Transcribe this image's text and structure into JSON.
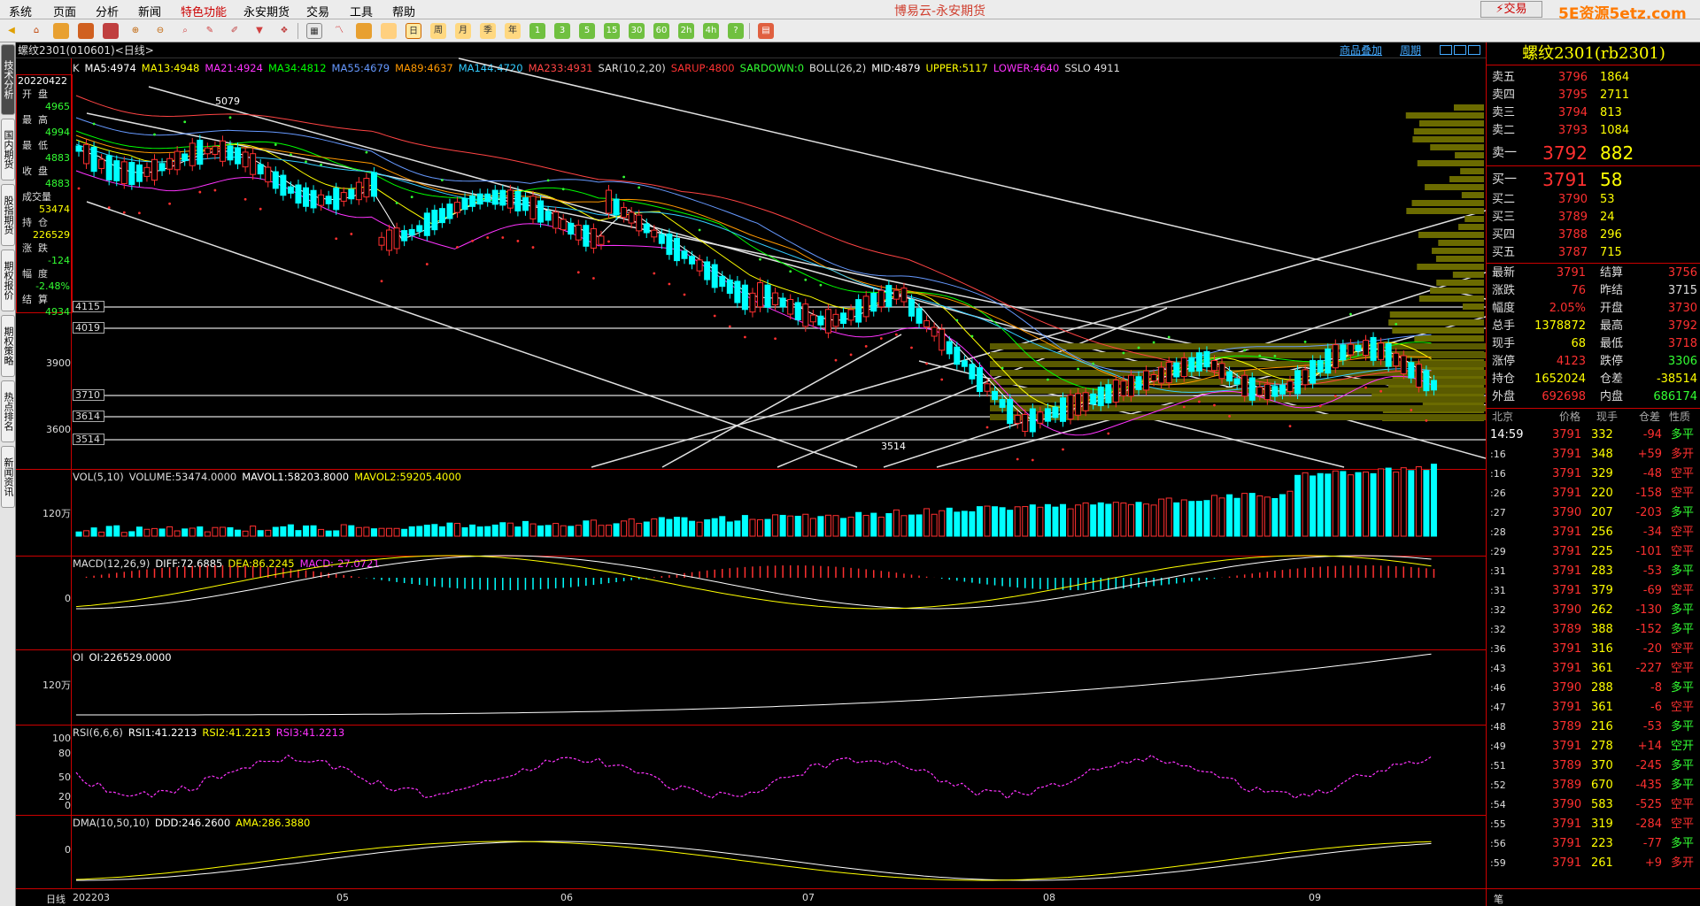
{
  "menu": [
    "系统",
    "页面",
    "分析",
    "新闻",
    "特色功能",
    "永安期货",
    "交易",
    "工具",
    "帮助"
  ],
  "app_title": "博易云-永安期货",
  "trade_button": "⚡交易",
  "watermark": "5E资源5etz.com",
  "side_tabs": [
    "技术分析",
    "国内期货",
    "股指期货",
    "期权报价",
    "期权策略",
    "热点排名",
    "新闻资讯"
  ],
  "chart_header": {
    "symbol": "螺纹2301(010601)<日线>",
    "overlay": "商品叠加",
    "period": "周期"
  },
  "info_panel": {
    "date": "20220422",
    "items": [
      {
        "label": "开盘",
        "value": "4965"
      },
      {
        "label": "最高",
        "value": "4994"
      },
      {
        "label": "最低",
        "value": "4883"
      },
      {
        "label": "收盘",
        "value": "4883"
      },
      {
        "label": "成交量",
        "value": "53474"
      },
      {
        "label": "持仓",
        "value": "226529"
      },
      {
        "label": "涨跌",
        "value": "-124"
      },
      {
        "label": "幅度",
        "value": "-2.48%"
      },
      {
        "label": "结算",
        "value": "4934"
      }
    ]
  },
  "main_indicators": [
    {
      "text": "K",
      "color": "#dddddd"
    },
    {
      "text": "MA5:4974",
      "color": "#ffffff"
    },
    {
      "text": "MA13:4948",
      "color": "#ffff00"
    },
    {
      "text": "MA21:4924",
      "color": "#ff33ff"
    },
    {
      "text": "MA34:4812",
      "color": "#00ff00"
    },
    {
      "text": "MA55:4679",
      "color": "#6699ff"
    },
    {
      "text": "MA89:4637",
      "color": "#ff9900"
    },
    {
      "text": "MA144:4720",
      "color": "#33ccff"
    },
    {
      "text": "MA233:4931",
      "color": "#ff4444"
    },
    {
      "text": "SAR(10,2,20)",
      "color": "#dddddd"
    },
    {
      "text": "SARUP:4800",
      "color": "#ff3333"
    },
    {
      "text": "SARDOWN:0",
      "color": "#33ff33"
    },
    {
      "text": "BOLL(26,2)",
      "color": "#dddddd"
    },
    {
      "text": "MID:4879",
      "color": "#ffffff"
    },
    {
      "text": "UPPER:5117",
      "color": "#ffff00"
    },
    {
      "text": "LOWER:4640",
      "color": "#ff33ff"
    },
    {
      "text": "SSLO 4911",
      "color": "#dddddd"
    }
  ],
  "price_labels": {
    "high": "5079",
    "low": "3514",
    "y1": "3900",
    "y2": "3600"
  },
  "levels": [
    "4115",
    "4019",
    "3710",
    "3614",
    "3514"
  ],
  "vol_indicators": [
    {
      "text": "VOL(5,10)",
      "color": "#dddddd"
    },
    {
      "text": "VOLUME:53474.0000",
      "color": "#dddddd"
    },
    {
      "text": "MAVOL1:58203.8000",
      "color": "#ffffff"
    },
    {
      "text": "MAVOL2:59205.4000",
      "color": "#ffff00"
    }
  ],
  "vol_ylabel": "120万",
  "macd_indicators": [
    {
      "text": "MACD(12,26,9)",
      "color": "#dddddd"
    },
    {
      "text": "DIFF:72.6885",
      "color": "#ffffff"
    },
    {
      "text": "DEA:86.2245",
      "color": "#ffff00"
    },
    {
      "text": "MACD:-27.0721",
      "color": "#ff33ff"
    }
  ],
  "macd_ylabel": "0",
  "oi_indicators": [
    {
      "text": "OI",
      "color": "#dddddd"
    },
    {
      "text": "OI:226529.0000",
      "color": "#ffffff"
    }
  ],
  "oi_ylabel": "120万",
  "rsi_indicators": [
    {
      "text": "RSI(6,6,6)",
      "color": "#dddddd"
    },
    {
      "text": "RSI1:41.2213",
      "color": "#ffffff"
    },
    {
      "text": "RSI2:41.2213",
      "color": "#ffff00"
    },
    {
      "text": "RSI3:41.2213",
      "color": "#ff33ff"
    }
  ],
  "rsi_ylabels": [
    "100",
    "80",
    "50",
    "20",
    "0"
  ],
  "dma_indicators": [
    {
      "text": "DMA(10,50,10)",
      "color": "#dddddd"
    },
    {
      "text": "DDD:246.2600",
      "color": "#ffffff"
    },
    {
      "text": "AMA:286.3880",
      "color": "#ffff00"
    }
  ],
  "dma_ylabel": "0",
  "x_axis": {
    "period": "日线",
    "labels": [
      "202203",
      "05",
      "06",
      "07",
      "08",
      "09"
    ]
  },
  "quote": {
    "title": "螺纹2301(rb2301)",
    "asks": [
      {
        "label": "卖五",
        "price": "3796",
        "vol": "1864"
      },
      {
        "label": "卖四",
        "price": "3795",
        "vol": "2711"
      },
      {
        "label": "卖三",
        "price": "3794",
        "vol": "813"
      },
      {
        "label": "卖二",
        "price": "3793",
        "vol": "1084"
      },
      {
        "label": "卖一",
        "price": "3792",
        "vol": "882"
      }
    ],
    "bids": [
      {
        "label": "买一",
        "price": "3791",
        "vol": "58"
      },
      {
        "label": "买二",
        "price": "3790",
        "vol": "53"
      },
      {
        "label": "买三",
        "price": "3789",
        "vol": "24"
      },
      {
        "label": "买四",
        "price": "3788",
        "vol": "296"
      },
      {
        "label": "买五",
        "price": "3787",
        "vol": "715"
      }
    ],
    "stats": [
      {
        "l1": "最新",
        "v1": "3791",
        "c1": "#ff3030",
        "l2": "结算",
        "v2": "3756",
        "c2": "#ff3030"
      },
      {
        "l1": "涨跌",
        "v1": "76",
        "c1": "#ff3030",
        "l2": "昨结",
        "v2": "3715",
        "c2": "#dddddd"
      },
      {
        "l1": "幅度",
        "v1": "2.05%",
        "c1": "#ff3030",
        "l2": "开盘",
        "v2": "3730",
        "c2": "#ff3030"
      },
      {
        "l1": "总手",
        "v1": "1378872",
        "c1": "#ffff00",
        "l2": "最高",
        "v2": "3792",
        "c2": "#ff3030"
      },
      {
        "l1": "现手",
        "v1": "68",
        "c1": "#ffff00",
        "l2": "最低",
        "v2": "3718",
        "c2": "#ff3030"
      },
      {
        "l1": "涨停",
        "v1": "4123",
        "c1": "#ff3030",
        "l2": "跌停",
        "v2": "3306",
        "c2": "#33ff33"
      },
      {
        "l1": "持仓",
        "v1": "1652024",
        "c1": "#ffff00",
        "l2": "仓差",
        "v2": "-38514",
        "c2": "#ffff00"
      },
      {
        "l1": "外盘",
        "v1": "692698",
        "c1": "#ff3030",
        "l2": "内盘",
        "v2": "686174",
        "c2": "#33ff33"
      }
    ],
    "ticks_header": {
      "place": "北京",
      "price": "价格",
      "vol": "现手",
      "oi": "仓差",
      "nature": "性质"
    },
    "ticks": [
      {
        "time": "14:59",
        "price": "3791",
        "vol": "332",
        "oi": "-94",
        "nature": "多平",
        "pc": "#ff3030",
        "nc": "#33ff33",
        "oc": "#ff3030"
      },
      {
        "time": ":16",
        "price": "3791",
        "vol": "348",
        "oi": "+59",
        "nature": "多开",
        "pc": "#ff3030",
        "nc": "#ff3030",
        "oc": "#ff3030"
      },
      {
        "time": ":16",
        "price": "3791",
        "vol": "329",
        "oi": "-48",
        "nature": "空平",
        "pc": "#ff3030",
        "nc": "#ff3030",
        "oc": "#ff3030"
      },
      {
        "time": ":26",
        "price": "3791",
        "vol": "220",
        "oi": "-158",
        "nature": "空平",
        "pc": "#ff3030",
        "nc": "#ff3030",
        "oc": "#ff3030"
      },
      {
        "time": ":27",
        "price": "3790",
        "vol": "207",
        "oi": "-203",
        "nature": "多平",
        "pc": "#ff3030",
        "nc": "#33ff33",
        "oc": "#ff3030"
      },
      {
        "time": ":28",
        "price": "3791",
        "vol": "256",
        "oi": "-34",
        "nature": "空平",
        "pc": "#ff3030",
        "nc": "#ff3030",
        "oc": "#ff3030"
      },
      {
        "time": ":29",
        "price": "3791",
        "vol": "225",
        "oi": "-101",
        "nature": "空平",
        "pc": "#ff3030",
        "nc": "#ff3030",
        "oc": "#ff3030"
      },
      {
        "time": ":31",
        "price": "3791",
        "vol": "283",
        "oi": "-53",
        "nature": "多平",
        "pc": "#ff3030",
        "nc": "#33ff33",
        "oc": "#ff3030"
      },
      {
        "time": ":31",
        "price": "3791",
        "vol": "379",
        "oi": "-69",
        "nature": "空平",
        "pc": "#ff3030",
        "nc": "#ff3030",
        "oc": "#ff3030"
      },
      {
        "time": ":32",
        "price": "3790",
        "vol": "262",
        "oi": "-130",
        "nature": "多平",
        "pc": "#ff3030",
        "nc": "#33ff33",
        "oc": "#ff3030"
      },
      {
        "time": ":32",
        "price": "3789",
        "vol": "388",
        "oi": "-152",
        "nature": "多平",
        "pc": "#ff3030",
        "nc": "#33ff33",
        "oc": "#ff3030"
      },
      {
        "time": ":36",
        "price": "3791",
        "vol": "316",
        "oi": "-20",
        "nature": "空平",
        "pc": "#ff3030",
        "nc": "#ff3030",
        "oc": "#ff3030"
      },
      {
        "time": ":43",
        "price": "3791",
        "vol": "361",
        "oi": "-227",
        "nature": "空平",
        "pc": "#ff3030",
        "nc": "#ff3030",
        "oc": "#ff3030"
      },
      {
        "time": ":46",
        "price": "3790",
        "vol": "288",
        "oi": "-8",
        "nature": "多平",
        "pc": "#ff3030",
        "nc": "#33ff33",
        "oc": "#ff3030"
      },
      {
        "time": ":47",
        "price": "3791",
        "vol": "361",
        "oi": "-6",
        "nature": "空平",
        "pc": "#ff3030",
        "nc": "#ff3030",
        "oc": "#ff3030"
      },
      {
        "time": ":48",
        "price": "3789",
        "vol": "216",
        "oi": "-53",
        "nature": "多平",
        "pc": "#ff3030",
        "nc": "#33ff33",
        "oc": "#ff3030"
      },
      {
        "time": ":49",
        "price": "3791",
        "vol": "278",
        "oi": "+14",
        "nature": "空开",
        "pc": "#ff3030",
        "nc": "#33ff33",
        "oc": "#ff3030"
      },
      {
        "time": ":51",
        "price": "3789",
        "vol": "370",
        "oi": "-245",
        "nature": "多平",
        "pc": "#ff3030",
        "nc": "#33ff33",
        "oc": "#ff3030"
      },
      {
        "time": ":52",
        "price": "3789",
        "vol": "670",
        "oi": "-435",
        "nature": "多平",
        "pc": "#ff3030",
        "nc": "#33ff33",
        "oc": "#ff3030"
      },
      {
        "time": ":54",
        "price": "3790",
        "vol": "583",
        "oi": "-525",
        "nature": "空平",
        "pc": "#ff3030",
        "nc": "#ff3030",
        "oc": "#ff3030"
      },
      {
        "time": ":55",
        "price": "3791",
        "vol": "319",
        "oi": "-284",
        "nature": "空平",
        "pc": "#ff3030",
        "nc": "#ff3030",
        "oc": "#ff3030"
      },
      {
        "time": ":56",
        "price": "3791",
        "vol": "223",
        "oi": "-77",
        "nature": "多平",
        "pc": "#ff3030",
        "nc": "#33ff33",
        "oc": "#ff3030"
      },
      {
        "time": ":59",
        "price": "3791",
        "vol": "261",
        "oi": "+9",
        "nature": "多开",
        "pc": "#ff3030",
        "nc": "#ff3030",
        "oc": "#ff3030"
      }
    ],
    "bottom_tab": "笔"
  },
  "colors": {
    "up": "#ff3030",
    "down": "#00ffff",
    "border": "#cc0000",
    "accent": "#ffff00"
  }
}
